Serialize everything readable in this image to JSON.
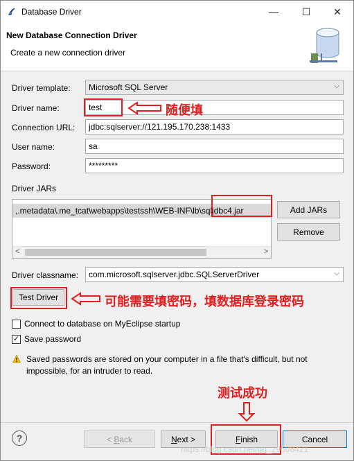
{
  "window": {
    "title": "Database Driver",
    "minimize": "—",
    "maximize": "☐",
    "close": "✕"
  },
  "header": {
    "title": "New Database Connection Driver",
    "subtitle": "Create a new connection driver"
  },
  "form": {
    "template_label": "Driver template:",
    "template_value": "Microsoft SQL Server",
    "name_label": "Driver name:",
    "name_value": "test",
    "url_label": "Connection URL:",
    "url_value": "jdbc:sqlserver://121.195.170.238:1433",
    "user_label": "User name:",
    "user_value": "sa",
    "password_label": "Password:",
    "password_value": "*********",
    "jars_label": "Driver JARs",
    "jar_path_main": ",.metadata\\.me_tcat\\webapps\\testssh\\WEB-INF\\l",
    "jar_path_file": "b\\sqljdbc4.jar",
    "classname_label": "Driver classname:",
    "classname_value": "com.microsoft.sqlserver.jdbc.SQLServerDriver"
  },
  "buttons": {
    "add_jars": "Add JARs",
    "remove": "Remove",
    "test_driver": "Test Driver",
    "back": "< Back",
    "back_mnemonic": "B",
    "next": "Next >",
    "next_mnemonic": "N",
    "finish": "Finish",
    "finish_mnemonic": "F",
    "cancel": "Cancel"
  },
  "options": {
    "connect_startup": {
      "label": "Connect to database on MyEclipse startup",
      "checked": false
    },
    "save_password": {
      "label": "Save password",
      "checked": true
    }
  },
  "warning": "Saved passwords are stored on your computer in a file that's difficult, but not impossible, for an intruder to read.",
  "annotations": {
    "name_note": "随便填",
    "test_note": "可能需要填密码，填数据库登录密码",
    "finish_note": "测试成功",
    "color": "#e02020"
  },
  "watermark": "https://blog.csdn.net/qq_29508421"
}
